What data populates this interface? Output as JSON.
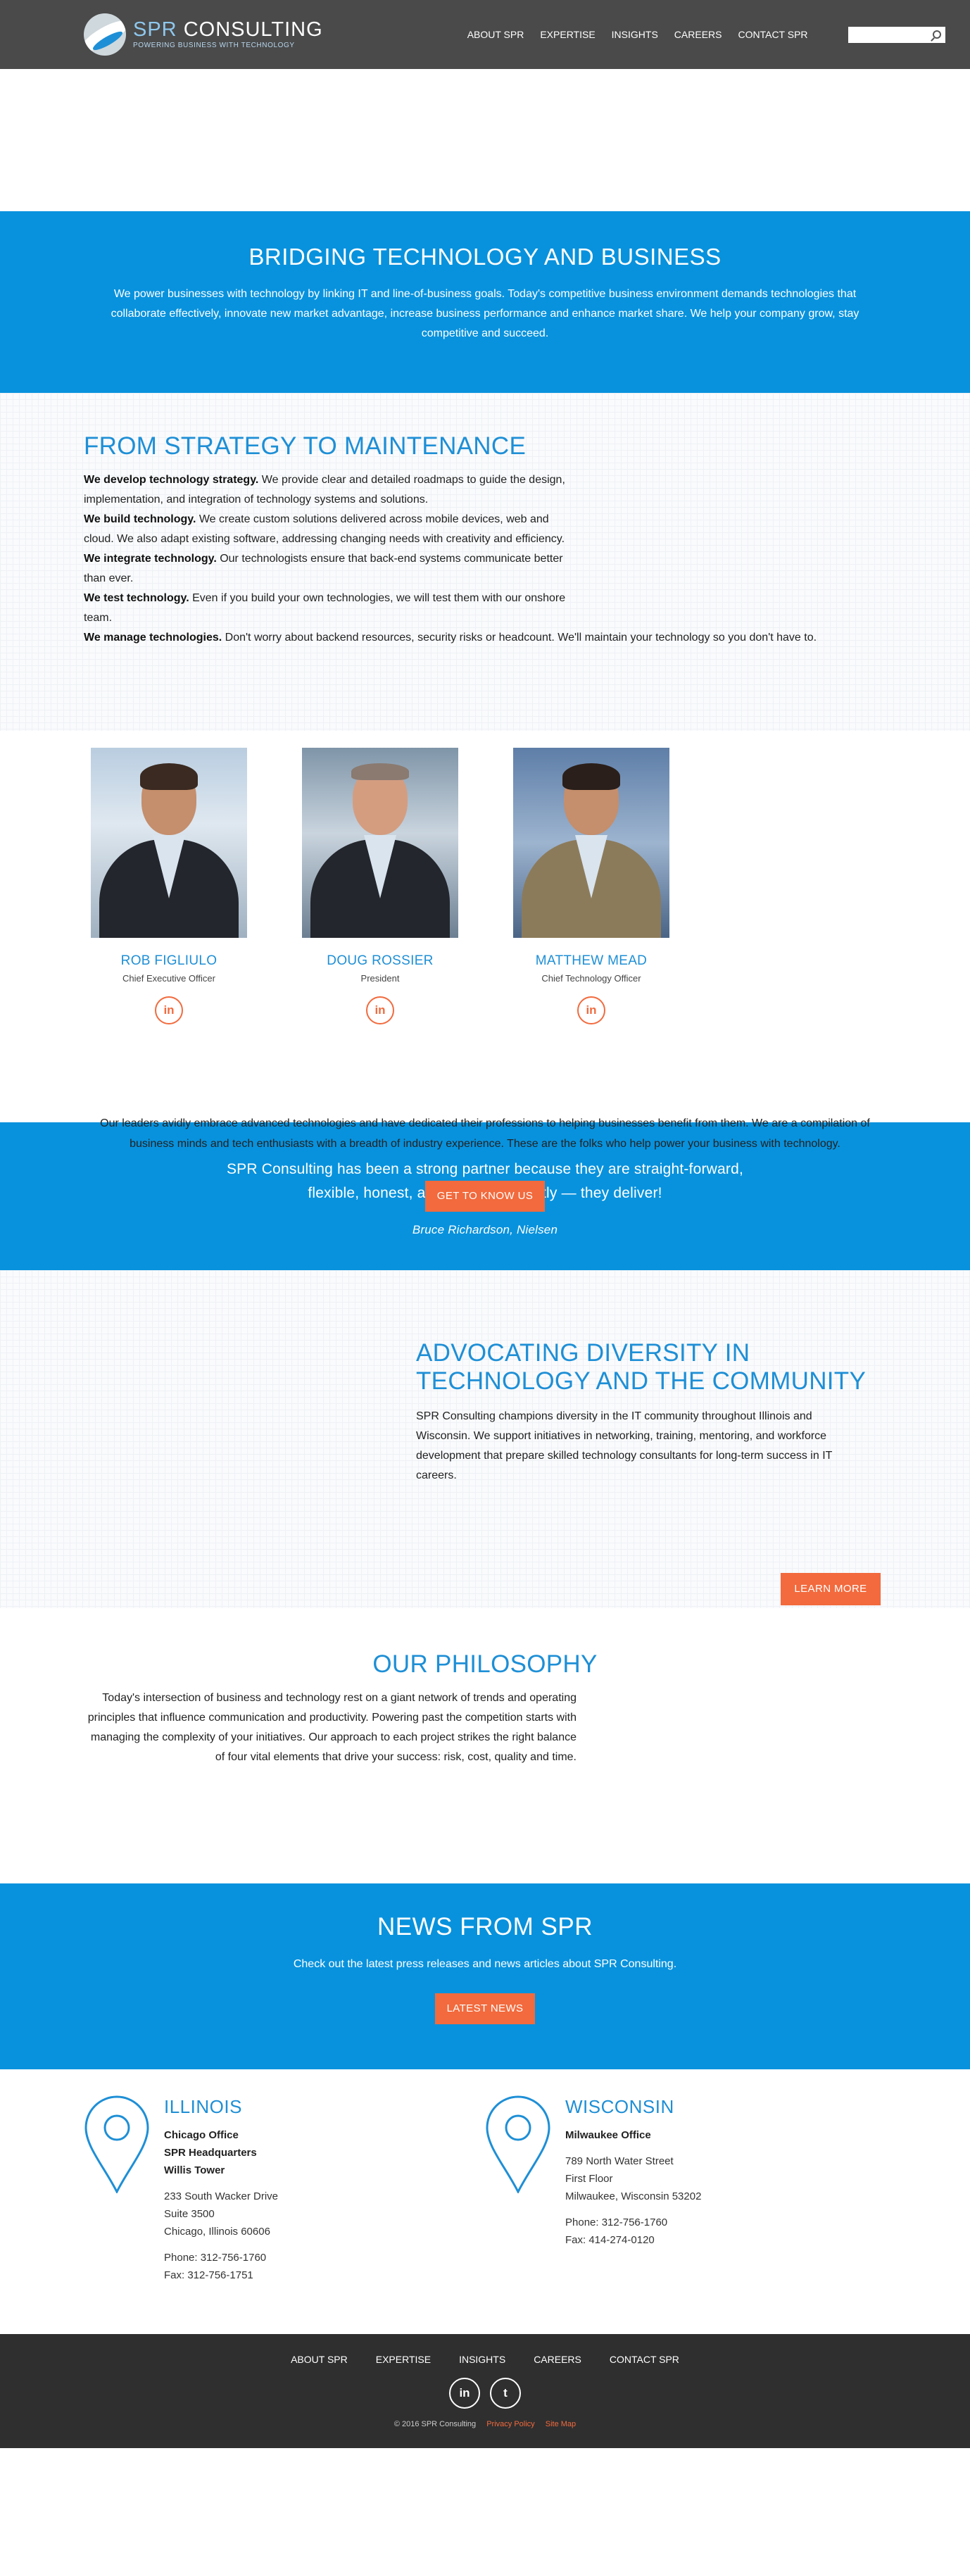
{
  "header": {
    "logo_spr": "SPR",
    "logo_consulting": " CONSULTING",
    "logo_tagline": "POWERING BUSINESS WITH TECHNOLOGY",
    "nav": [
      "ABOUT SPR",
      "EXPERTISE",
      "INSIGHTS",
      "CAREERS",
      "CONTACT SPR"
    ],
    "search_value": ""
  },
  "hero": {
    "title": "BRIDGING TECHNOLOGY AND BUSINESS",
    "text": "We power businesses with technology by linking IT and line-of-business goals. Today's competitive business environment demands technologies that collaborate effectively, innovate new market advantage, increase business performance and enhance market share. We help your company grow, stay competitive and succeed."
  },
  "strategy": {
    "title": "FROM STRATEGY TO MAINTENANCE",
    "items": [
      {
        "lead": "We develop technology strategy.",
        "text": " We provide clear and detailed roadmaps to guide the design, implementation, and integration of technology systems and solutions."
      },
      {
        "lead": "We build technology.",
        "text": " We create custom solutions delivered across mobile devices, web and cloud. We also adapt existing software, addressing changing needs with creativity and efficiency."
      },
      {
        "lead": "We integrate technology.",
        "text": " Our technologists ensure that back-end systems communicate better than ever."
      },
      {
        "lead": "We test technology.",
        "text": " Even if you build your own technologies, we will test them with our onshore team."
      },
      {
        "lead": "We manage technologies.",
        "text": " Don't worry about backend resources, security risks or headcount. We'll maintain your technology so you don't have to."
      }
    ]
  },
  "leaders": {
    "people": [
      {
        "name": "ROB FIGLIULO",
        "role": "Chief Executive Officer",
        "icon": "linkedin-icon"
      },
      {
        "name": "DOUG ROSSIER",
        "role": "President",
        "icon": "linkedin-icon"
      },
      {
        "name": "MATTHEW MEAD",
        "role": "Chief Technology Officer",
        "icon": "linkedin-icon"
      }
    ],
    "linkedin_glyph": "in",
    "text": "Our leaders avidly embrace advanced technologies and have dedicated their professions to helping businesses benefit from them. We are a compilation of business minds and tech enthusiasts with a breadth of industry experience. These are the folks who help power your business with technology.",
    "button": "GET TO KNOW US"
  },
  "quote": {
    "text": "SPR Consulting has been a strong partner because they are straight-forward, flexible, honest, and most importantly — they deliver!",
    "cite": "Bruce Richardson, Nielsen"
  },
  "diversity": {
    "title": "ADVOCATING DIVERSITY IN TECHNOLOGY AND THE COMMUNITY",
    "text": "SPR Consulting champions diversity in the IT community throughout Illinois and Wisconsin. We support initiatives in networking, training, mentoring, and workforce development that prepare skilled technology consultants for long-term success in IT careers.",
    "button": "LEARN MORE"
  },
  "philosophy": {
    "title": "OUR PHILOSOPHY",
    "text": "Today's intersection of business and technology rest on a giant network of trends and operating principles that influence communication and productivity. Powering past the competition starts with managing the complexity of your initiatives. Our approach to each project strikes the right balance of four vital elements that drive your success: risk, cost, quality and time."
  },
  "news": {
    "title": "NEWS FROM SPR",
    "text": "Check out the latest press releases and news articles about SPR Consulting.",
    "button": "LATEST NEWS"
  },
  "offices": {
    "illinois": {
      "title": "ILLINOIS",
      "bold_lines": [
        "Chicago Office",
        "SPR Headquarters",
        "Willis Tower"
      ],
      "address": [
        "233 South Wacker Drive",
        "Suite 3500",
        "Chicago, Illinois  60606"
      ],
      "phone": "Phone: 312-756-1760",
      "fax": "Fax: 312-756-1751"
    },
    "wisconsin": {
      "title": "WISCONSIN",
      "bold_lines": [
        "Milwaukee Office"
      ],
      "address": [
        "789 North Water Street",
        "First Floor",
        "Milwaukee, Wisconsin  53202"
      ],
      "phone": "Phone: 312-756-1760",
      "fax": "Fax: 414-274-0120"
    }
  },
  "footer": {
    "nav": [
      "ABOUT SPR",
      "EXPERTISE",
      "INSIGHTS",
      "CAREERS",
      "CONTACT SPR"
    ],
    "linkedin_glyph": "in",
    "twitter_glyph": "t",
    "copyright": "© 2016 SPR Consulting",
    "privacy": "Privacy Policy",
    "sitemap": "Site Map"
  },
  "colors": {
    "brand_blue": "#0892dd",
    "accent_orange": "#f26a3d",
    "header_gray": "#4a4a4a",
    "footer_gray": "#2f2f2f"
  }
}
